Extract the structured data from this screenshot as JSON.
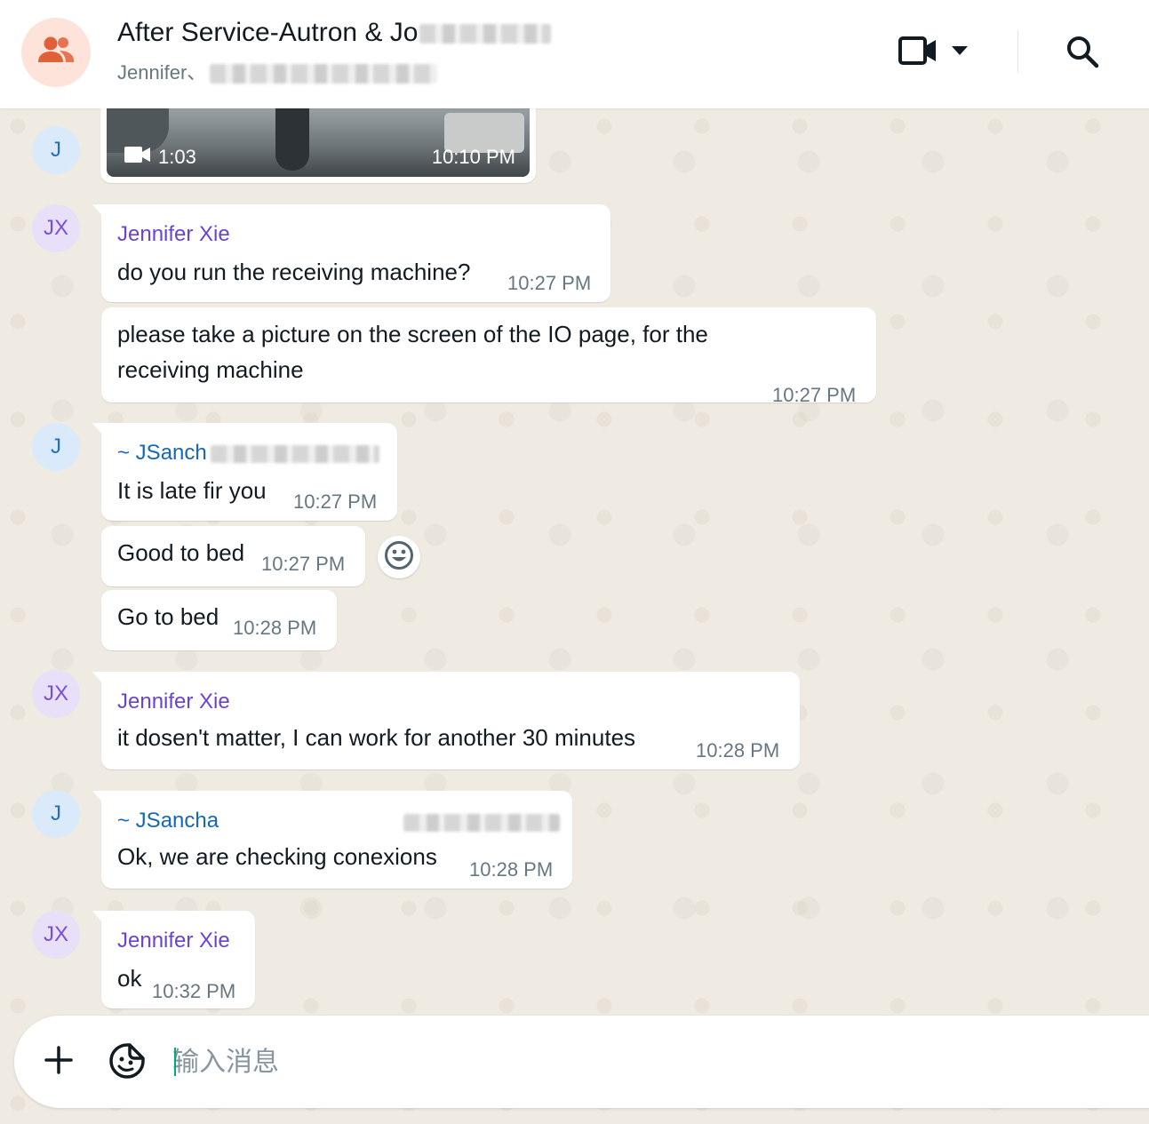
{
  "header": {
    "title": "After Service-Autron & Jo",
    "subtitle": "Jennifer、",
    "icons": [
      "group-icon",
      "video-camera-icon",
      "dropdown-arrow-icon",
      "search-icon"
    ]
  },
  "messages": {
    "video": {
      "sender_avatar": "J",
      "duration": "1:03",
      "time": "10:10 PM"
    },
    "m1": {
      "avatar": "JX",
      "sender": "Jennifer Xie",
      "text": "do you run the receiving machine?",
      "time": "10:27 PM"
    },
    "m2": {
      "line1": "please take a picture on the screen of the IO page, for the",
      "line2": "receiving machine",
      "time": "10:27 PM"
    },
    "m3": {
      "avatar": "J",
      "sender": "~ JSanch",
      "text": "It is late fir you",
      "time": "10:27 PM"
    },
    "m4": {
      "text": "Good to bed",
      "time": "10:27 PM"
    },
    "m5": {
      "text": "Go to bed",
      "time": "10:28 PM"
    },
    "m6": {
      "avatar": "JX",
      "sender": "Jennifer Xie",
      "text": "it dosen't matter, I can work for another 30 minutes",
      "time": "10:28 PM"
    },
    "m7": {
      "avatar": "J",
      "sender": "~ JSancha",
      "text": "Ok, we are checking conexions",
      "time": "10:28 PM"
    },
    "m8": {
      "avatar": "JX",
      "sender": "Jennifer Xie",
      "text": "ok",
      "time": "10:32 PM"
    }
  },
  "composer": {
    "placeholder": "输入消息",
    "icons": [
      "plus-icon",
      "sticker-icon"
    ]
  },
  "colors": {
    "purple_sender": "#6a43d0",
    "blue_sender": "#1568b8",
    "chat_bg": "#efeae2",
    "group_avatar_bg": "#fde3d9",
    "group_avatar_icon": "#e0603a"
  }
}
